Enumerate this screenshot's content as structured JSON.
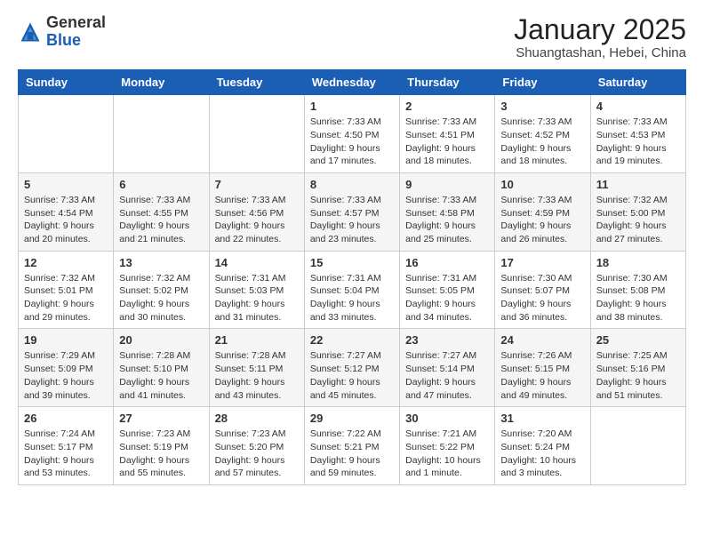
{
  "header": {
    "logo_general": "General",
    "logo_blue": "Blue",
    "month_title": "January 2025",
    "location": "Shuangtashan, Hebei, China"
  },
  "days_of_week": [
    "Sunday",
    "Monday",
    "Tuesday",
    "Wednesday",
    "Thursday",
    "Friday",
    "Saturday"
  ],
  "weeks": [
    [
      {
        "day": "",
        "info": ""
      },
      {
        "day": "",
        "info": ""
      },
      {
        "day": "",
        "info": ""
      },
      {
        "day": "1",
        "info": "Sunrise: 7:33 AM\nSunset: 4:50 PM\nDaylight: 9 hours\nand 17 minutes."
      },
      {
        "day": "2",
        "info": "Sunrise: 7:33 AM\nSunset: 4:51 PM\nDaylight: 9 hours\nand 18 minutes."
      },
      {
        "day": "3",
        "info": "Sunrise: 7:33 AM\nSunset: 4:52 PM\nDaylight: 9 hours\nand 18 minutes."
      },
      {
        "day": "4",
        "info": "Sunrise: 7:33 AM\nSunset: 4:53 PM\nDaylight: 9 hours\nand 19 minutes."
      }
    ],
    [
      {
        "day": "5",
        "info": "Sunrise: 7:33 AM\nSunset: 4:54 PM\nDaylight: 9 hours\nand 20 minutes."
      },
      {
        "day": "6",
        "info": "Sunrise: 7:33 AM\nSunset: 4:55 PM\nDaylight: 9 hours\nand 21 minutes."
      },
      {
        "day": "7",
        "info": "Sunrise: 7:33 AM\nSunset: 4:56 PM\nDaylight: 9 hours\nand 22 minutes."
      },
      {
        "day": "8",
        "info": "Sunrise: 7:33 AM\nSunset: 4:57 PM\nDaylight: 9 hours\nand 23 minutes."
      },
      {
        "day": "9",
        "info": "Sunrise: 7:33 AM\nSunset: 4:58 PM\nDaylight: 9 hours\nand 25 minutes."
      },
      {
        "day": "10",
        "info": "Sunrise: 7:33 AM\nSunset: 4:59 PM\nDaylight: 9 hours\nand 26 minutes."
      },
      {
        "day": "11",
        "info": "Sunrise: 7:32 AM\nSunset: 5:00 PM\nDaylight: 9 hours\nand 27 minutes."
      }
    ],
    [
      {
        "day": "12",
        "info": "Sunrise: 7:32 AM\nSunset: 5:01 PM\nDaylight: 9 hours\nand 29 minutes."
      },
      {
        "day": "13",
        "info": "Sunrise: 7:32 AM\nSunset: 5:02 PM\nDaylight: 9 hours\nand 30 minutes."
      },
      {
        "day": "14",
        "info": "Sunrise: 7:31 AM\nSunset: 5:03 PM\nDaylight: 9 hours\nand 31 minutes."
      },
      {
        "day": "15",
        "info": "Sunrise: 7:31 AM\nSunset: 5:04 PM\nDaylight: 9 hours\nand 33 minutes."
      },
      {
        "day": "16",
        "info": "Sunrise: 7:31 AM\nSunset: 5:05 PM\nDaylight: 9 hours\nand 34 minutes."
      },
      {
        "day": "17",
        "info": "Sunrise: 7:30 AM\nSunset: 5:07 PM\nDaylight: 9 hours\nand 36 minutes."
      },
      {
        "day": "18",
        "info": "Sunrise: 7:30 AM\nSunset: 5:08 PM\nDaylight: 9 hours\nand 38 minutes."
      }
    ],
    [
      {
        "day": "19",
        "info": "Sunrise: 7:29 AM\nSunset: 5:09 PM\nDaylight: 9 hours\nand 39 minutes."
      },
      {
        "day": "20",
        "info": "Sunrise: 7:28 AM\nSunset: 5:10 PM\nDaylight: 9 hours\nand 41 minutes."
      },
      {
        "day": "21",
        "info": "Sunrise: 7:28 AM\nSunset: 5:11 PM\nDaylight: 9 hours\nand 43 minutes."
      },
      {
        "day": "22",
        "info": "Sunrise: 7:27 AM\nSunset: 5:12 PM\nDaylight: 9 hours\nand 45 minutes."
      },
      {
        "day": "23",
        "info": "Sunrise: 7:27 AM\nSunset: 5:14 PM\nDaylight: 9 hours\nand 47 minutes."
      },
      {
        "day": "24",
        "info": "Sunrise: 7:26 AM\nSunset: 5:15 PM\nDaylight: 9 hours\nand 49 minutes."
      },
      {
        "day": "25",
        "info": "Sunrise: 7:25 AM\nSunset: 5:16 PM\nDaylight: 9 hours\nand 51 minutes."
      }
    ],
    [
      {
        "day": "26",
        "info": "Sunrise: 7:24 AM\nSunset: 5:17 PM\nDaylight: 9 hours\nand 53 minutes."
      },
      {
        "day": "27",
        "info": "Sunrise: 7:23 AM\nSunset: 5:19 PM\nDaylight: 9 hours\nand 55 minutes."
      },
      {
        "day": "28",
        "info": "Sunrise: 7:23 AM\nSunset: 5:20 PM\nDaylight: 9 hours\nand 57 minutes."
      },
      {
        "day": "29",
        "info": "Sunrise: 7:22 AM\nSunset: 5:21 PM\nDaylight: 9 hours\nand 59 minutes."
      },
      {
        "day": "30",
        "info": "Sunrise: 7:21 AM\nSunset: 5:22 PM\nDaylight: 10 hours\nand 1 minute."
      },
      {
        "day": "31",
        "info": "Sunrise: 7:20 AM\nSunset: 5:24 PM\nDaylight: 10 hours\nand 3 minutes."
      },
      {
        "day": "",
        "info": ""
      }
    ]
  ]
}
